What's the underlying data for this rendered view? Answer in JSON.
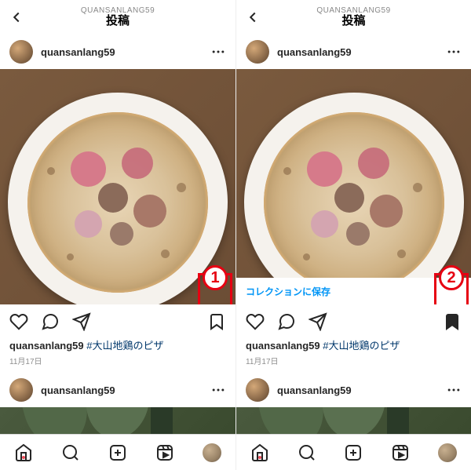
{
  "header": {
    "username_small": "QUANSANLANG59",
    "title": "投稿"
  },
  "post": {
    "username": "quansanlang59",
    "caption_user": "quansanlang59",
    "hashtag": "#大山地鶏のピザ",
    "date": "11月17日"
  },
  "toast": {
    "text": "コレクションに保存"
  },
  "annotations": {
    "left": "1",
    "right": "2"
  }
}
